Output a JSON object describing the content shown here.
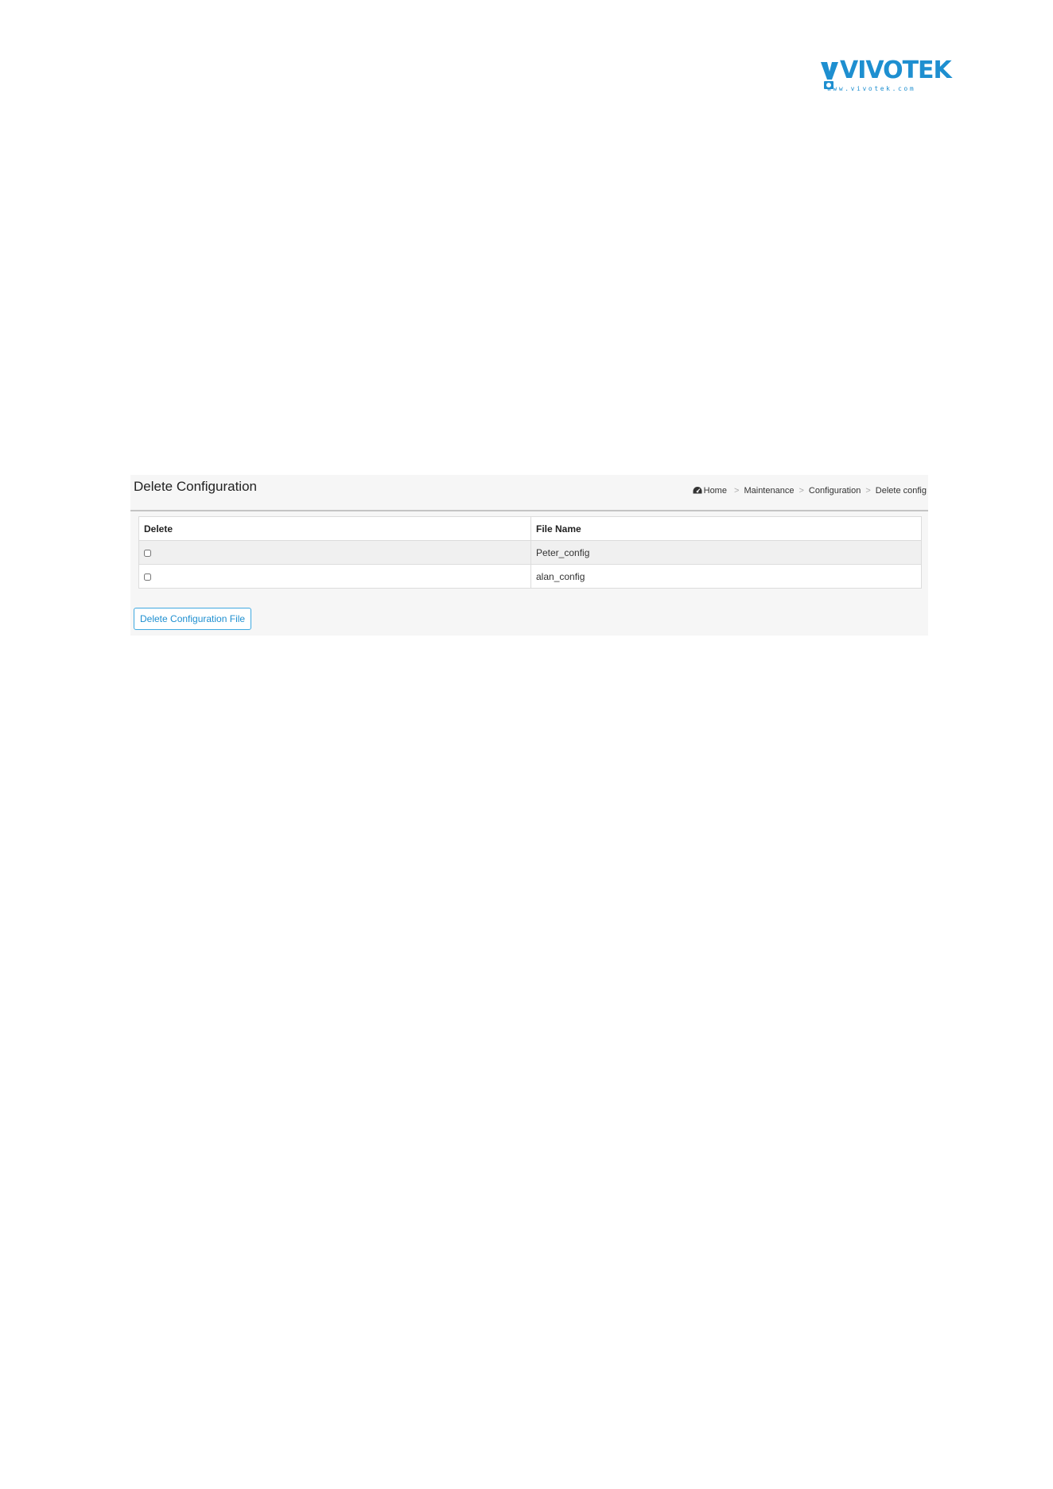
{
  "logo": {
    "word": "VIVOTEK",
    "url": "www.vivotek.com",
    "color": "#1e8fd0"
  },
  "page": {
    "title": "Delete Configuration",
    "breadcrumb": {
      "home": "Home",
      "separator": ">",
      "items": [
        "Maintenance",
        "Configuration",
        "Delete config"
      ]
    }
  },
  "table": {
    "headers": [
      "Delete",
      "File Name"
    ],
    "rows": [
      {
        "checked": false,
        "file_name": "Peter_config"
      },
      {
        "checked": false,
        "file_name": "alan_config"
      }
    ]
  },
  "actions": {
    "delete_button_label": "Delete Configuration File"
  },
  "icons": {
    "home": "dashboard-icon"
  }
}
